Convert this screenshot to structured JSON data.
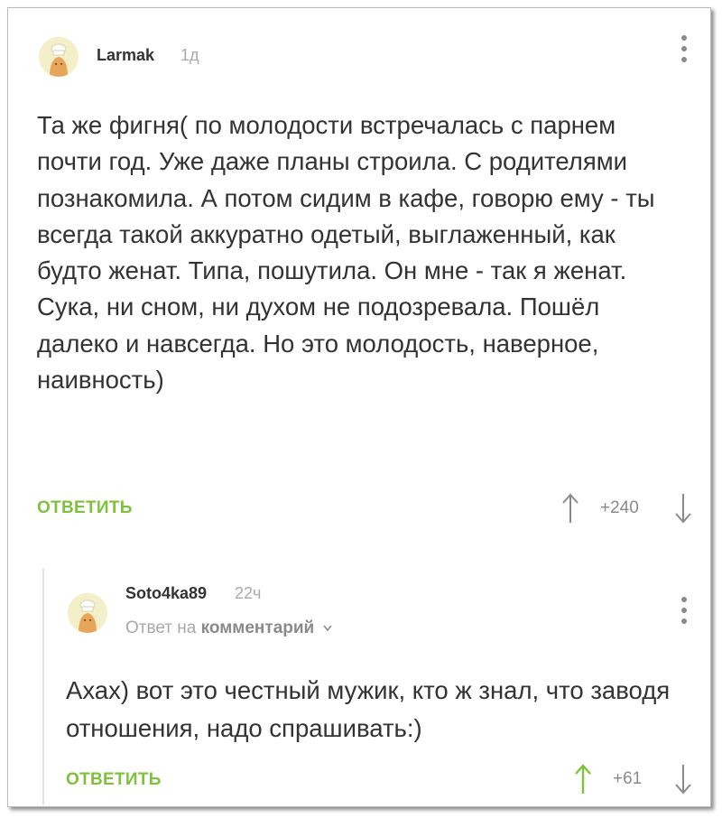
{
  "comments": [
    {
      "username": "Larmak",
      "time": "1д",
      "text": "Та же фигня( по молодости встречалась с парнем почти год. Уже даже планы строила. С родителями познакомила. А потом сидим в кафе, говорю ему - ты всегда такой аккуратно одетый, выглаженный, как будто женат. Типа, пошутила. Он мне - так я женат. Сука, ни сном, ни духом не подозревала. Пошёл далеко и навсегда. Но это молодость, наверное, наивность)",
      "reply_label": "ОТВЕТИТЬ",
      "rating": "+240"
    },
    {
      "username": "Soto4ka89",
      "time": "22ч",
      "reply_prefix": "Ответ на",
      "reply_target": "комментарий",
      "text": "Ахах) вот это честный мужик, кто ж знал, что заводя отношения, надо спрашивать:)",
      "reply_label": "ОТВЕТИТЬ",
      "rating": "+61"
    }
  ],
  "colors": {
    "accent": "#7fc13d",
    "text": "#333333",
    "muted": "#8a8a8a",
    "avatar_bg": "#f3efc8",
    "avatar_figure": "#e8a65a"
  },
  "icons": {
    "avatar": "chef-avatar-icon",
    "menu": "more-vertical-icon",
    "upvote": "arrow-up-icon",
    "downvote": "arrow-down-icon",
    "expand": "chevron-down-icon"
  }
}
